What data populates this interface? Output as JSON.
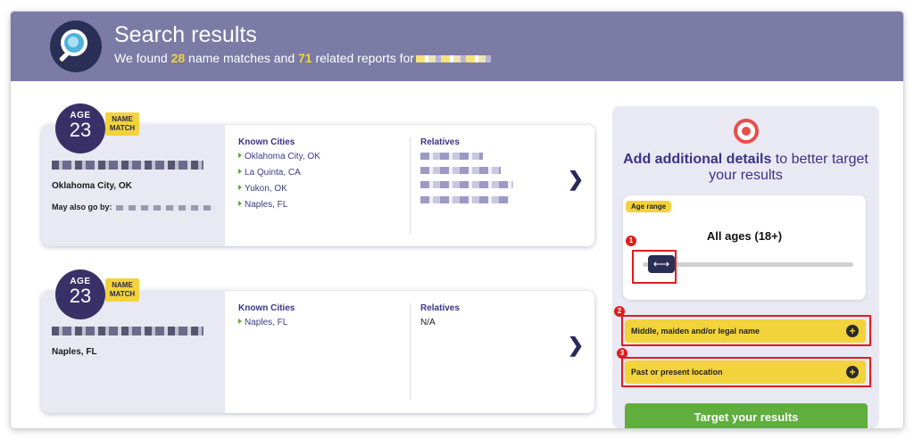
{
  "header": {
    "title": "Search results",
    "subtitle_pre": "We found ",
    "name_matches": "28",
    "subtitle_mid": " name matches and ",
    "related_reports": "71",
    "subtitle_post": " related reports for"
  },
  "results": [
    {
      "age_label": "AGE",
      "age": "23",
      "name_match": "NAME MATCH",
      "location": "Oklahoma City, OK",
      "aka_label": "May also go by:",
      "known_cities_label": "Known Cities",
      "known_cities": [
        "Oklahoma City, OK",
        "La Quinta, CA",
        "Yukon, OK",
        "Naples, FL"
      ],
      "relatives_label": "Relatives",
      "relatives_value": ""
    },
    {
      "age_label": "AGE",
      "age": "23",
      "name_match": "NAME MATCH",
      "location": "Naples, FL",
      "aka_label": "",
      "known_cities_label": "Known Cities",
      "known_cities": [
        "Naples, FL"
      ],
      "relatives_label": "Relatives",
      "relatives_value": "N/A"
    }
  ],
  "panel": {
    "title_bold": "Add additional details",
    "title_rest": " to better target your results",
    "age_range_label": "Age range",
    "age_range_value": "All ages (18+)",
    "slider_icon": "left-right-arrow-icon",
    "expanders": [
      "Middle, maiden and/or legal name",
      "Past or present location"
    ],
    "submit_label": "Target your results"
  },
  "annotations": [
    "1",
    "2",
    "3"
  ],
  "colors": {
    "header_bg": "#7b7ba6",
    "accent_yellow": "#f2d33b",
    "brand_navy": "#3a3068",
    "button_green": "#5fae3e",
    "highlight_red": "#e11c1c"
  }
}
